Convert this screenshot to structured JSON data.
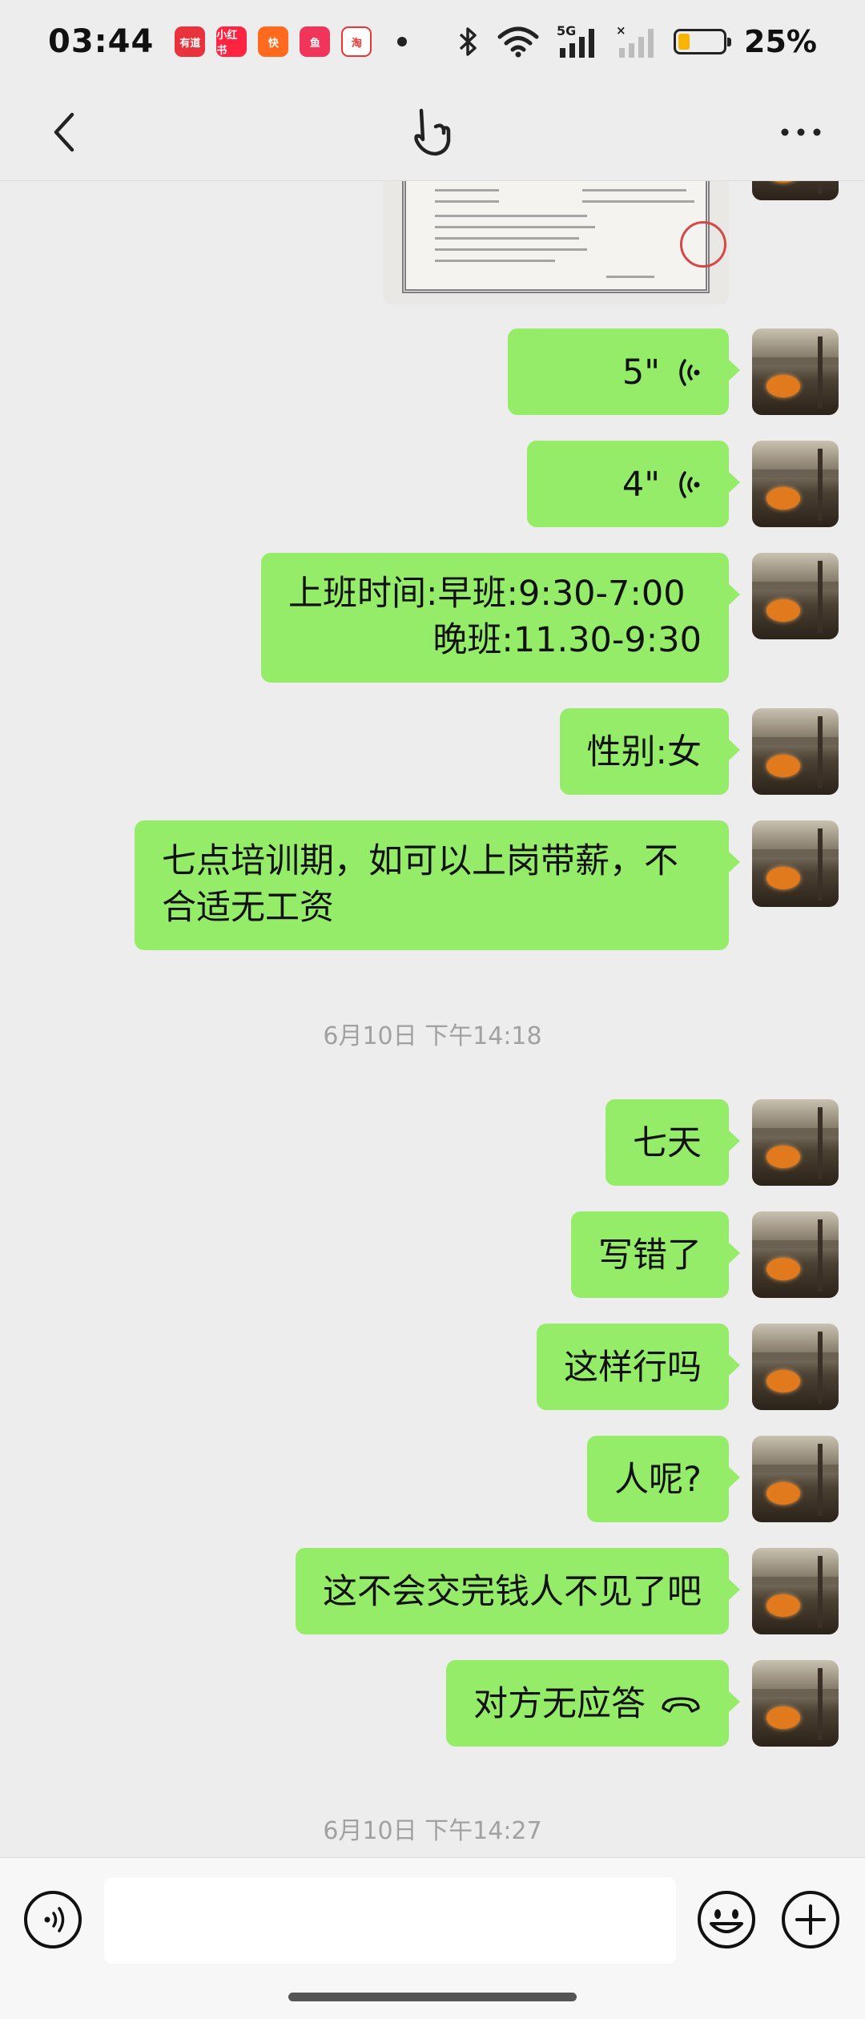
{
  "status_bar": {
    "time": "03:44",
    "notifications": [
      {
        "name": "youdao-icon",
        "text": "有道"
      },
      {
        "name": "xiaohongshu-icon",
        "text": "小红书"
      },
      {
        "name": "kuaishou-icon",
        "text": "快"
      },
      {
        "name": "xianyu-icon",
        "text": "鱼"
      },
      {
        "name": "taobao-icon",
        "text": "淘"
      }
    ],
    "network": "5G",
    "battery_level": 0.25,
    "battery_text": "25%"
  },
  "nav": {
    "back_icon": "chevron-left-icon",
    "title_icon": "hand-icon",
    "more_icon": "more-dots-icon"
  },
  "messages": [
    {
      "type": "image",
      "alt": "business-license-image"
    },
    {
      "type": "voice",
      "duration": "5\""
    },
    {
      "type": "voice",
      "duration": "4\""
    },
    {
      "type": "text",
      "lines": [
        "上班时间:早班:9:30-7:00",
        "晚班:11.30-9:30"
      ]
    },
    {
      "type": "text",
      "text": "性别:女"
    },
    {
      "type": "text",
      "lines": [
        "七点培训期，如可以上岗带薪，不",
        "合适无工资"
      ]
    },
    {
      "type": "timestamp",
      "text": "6月10日 下午14:18"
    },
    {
      "type": "text",
      "text": "七天"
    },
    {
      "type": "text",
      "text": "写错了"
    },
    {
      "type": "text",
      "text": "这样行吗"
    },
    {
      "type": "text",
      "text": "人呢?"
    },
    {
      "type": "text",
      "text": "这不会交完钱人不见了吧"
    },
    {
      "type": "call",
      "text": "对方无应答"
    },
    {
      "type": "timestamp",
      "text": "6月10日 下午14:27"
    }
  ],
  "input_bar": {
    "voice_icon": "voice-input-icon",
    "placeholder": "",
    "emoji_icon": "emoji-icon",
    "plus_icon": "plus-icon"
  }
}
